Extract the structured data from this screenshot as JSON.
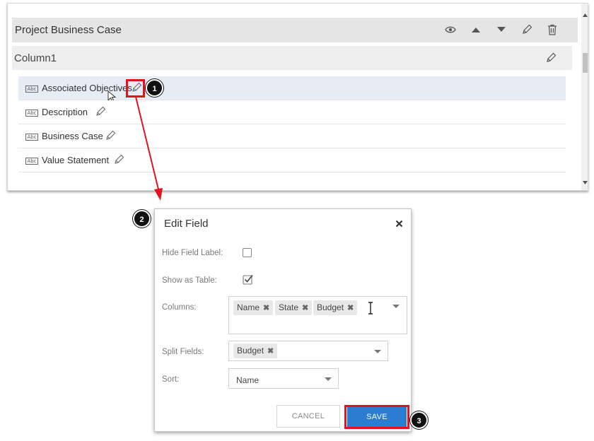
{
  "designer": {
    "section_title": "Project Business Case",
    "column_title": "Column1",
    "fields": [
      {
        "label": "Associated Objectives"
      },
      {
        "label": "Description"
      },
      {
        "label": "Business Case"
      },
      {
        "label": "Value Statement"
      }
    ],
    "field_type_badge": "Abc"
  },
  "annotations": {
    "step1": "1",
    "step2": "2",
    "step3": "3",
    "highlight_color": "#e0141e"
  },
  "dialog": {
    "title": "Edit Field",
    "hide_label": "Hide Field Label:",
    "hide_checked": false,
    "table_label": "Show as Table:",
    "table_checked": true,
    "columns_label": "Columns:",
    "columns": [
      "Name",
      "State",
      "Budget"
    ],
    "split_label": "Split Fields:",
    "split_fields": [
      "Budget"
    ],
    "sort_label": "Sort:",
    "sort_value": "Name",
    "cancel_label": "CANCEL",
    "save_label": "SAVE",
    "save_color": "#2a7dd1"
  }
}
